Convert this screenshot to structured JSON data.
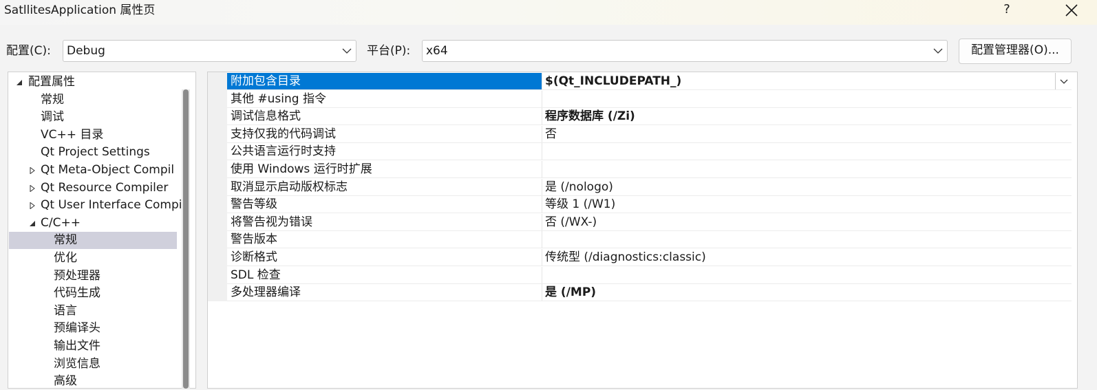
{
  "window": {
    "title": "SatllitesApplication 属性页",
    "help_label": "?",
    "close_icon": "close-icon"
  },
  "toolbar": {
    "config_label": "配置(C):",
    "config_value": "Debug",
    "platform_label": "平台(P):",
    "platform_value": "x64",
    "config_manager_label": "配置管理器(O)..."
  },
  "tree": {
    "items": [
      {
        "label": "配置属性",
        "expander": "expanded"
      },
      {
        "label": "常规",
        "expander": "none"
      },
      {
        "label": "调试",
        "expander": "none"
      },
      {
        "label": "VC++ 目录",
        "expander": "none"
      },
      {
        "label": "Qt Project Settings",
        "expander": "none"
      },
      {
        "label": "Qt Meta-Object Compil",
        "expander": "collapsed"
      },
      {
        "label": "Qt Resource Compiler",
        "expander": "collapsed"
      },
      {
        "label": "Qt User Interface Compi",
        "expander": "collapsed"
      },
      {
        "label": "C/C++",
        "expander": "expanded"
      },
      {
        "label": "常规",
        "expander": "none",
        "selected": true
      },
      {
        "label": "优化",
        "expander": "none"
      },
      {
        "label": "预处理器",
        "expander": "none"
      },
      {
        "label": "代码生成",
        "expander": "none"
      },
      {
        "label": "语言",
        "expander": "none"
      },
      {
        "label": "预编译头",
        "expander": "none"
      },
      {
        "label": "输出文件",
        "expander": "none"
      },
      {
        "label": "浏览信息",
        "expander": "none"
      },
      {
        "label": "高级",
        "expander": "none"
      }
    ]
  },
  "properties": {
    "rows": [
      {
        "name": "附加包含目录",
        "value": "$(Qt_INCLUDEPATH_)",
        "bold": true,
        "selected": true
      },
      {
        "name": "其他 #using 指令",
        "value": "",
        "bold": false
      },
      {
        "name": "调试信息格式",
        "value": "程序数据库 (/Zi)",
        "bold": true
      },
      {
        "name": "支持仅我的代码调试",
        "value": "否",
        "bold": false
      },
      {
        "name": "公共语言运行时支持",
        "value": "",
        "bold": false
      },
      {
        "name": "使用 Windows 运行时扩展",
        "value": "",
        "bold": false
      },
      {
        "name": "取消显示启动版权标志",
        "value": "是 (/nologo)",
        "bold": false
      },
      {
        "name": "警告等级",
        "value": "等级 1 (/W1)",
        "bold": false
      },
      {
        "name": "将警告视为错误",
        "value": "否 (/WX-)",
        "bold": false
      },
      {
        "name": "警告版本",
        "value": "",
        "bold": false
      },
      {
        "name": "诊断格式",
        "value": "传统型 (/diagnostics:classic)",
        "bold": false
      },
      {
        "name": "SDL 检查",
        "value": "",
        "bold": false
      },
      {
        "name": "多处理器编译",
        "value": "是 (/MP)",
        "bold": true
      }
    ]
  },
  "colors": {
    "selection_blue": "#0078d4",
    "tree_selection": "#d0d0dc"
  }
}
